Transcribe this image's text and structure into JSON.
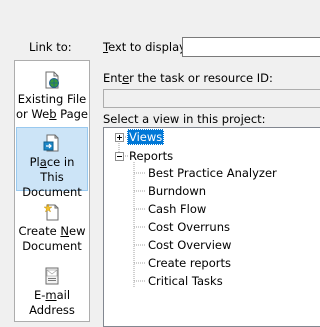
{
  "link_to": {
    "label": "Link to:",
    "items": [
      {
        "line1_pre": "",
        "line1_u": "",
        "line1_post": "Existing File",
        "line2_pre": "or We",
        "line2_u": "b",
        "line2_post": " Page",
        "icon": "globe-file-icon",
        "selected": false
      },
      {
        "line1_pre": "Pl",
        "line1_u": "a",
        "line1_post": "ce in This",
        "line2_pre": "Document",
        "line2_u": "",
        "line2_post": "",
        "icon": "document-arrow-icon",
        "selected": true
      },
      {
        "line1_pre": "Create ",
        "line1_u": "N",
        "line1_post": "ew",
        "line2_pre": "Document",
        "line2_u": "",
        "line2_post": "",
        "icon": "new-document-icon",
        "selected": false
      },
      {
        "line1_pre": "E-",
        "line1_u": "m",
        "line1_post": "ail",
        "line2_pre": "Address",
        "line2_u": "",
        "line2_post": "",
        "icon": "email-icon",
        "selected": false
      }
    ]
  },
  "text_to_display": {
    "label_u": "T",
    "label_rest": "ext to display:",
    "value": ""
  },
  "task_id": {
    "label_pre": "Ent",
    "label_u": "e",
    "label_post": "r the task or resource ID:",
    "value": ""
  },
  "views": {
    "label_pre": "Select a view in this pro",
    "label_u": "j",
    "label_post": "ect:",
    "root_views": "Views",
    "root_reports": "Reports",
    "reports": [
      "Best Practice Analyzer",
      "Burndown",
      "Cash Flow",
      "Cost Overruns",
      "Cost Overview",
      "Create reports",
      "Critical Tasks"
    ]
  },
  "colors": {
    "selection": "#0078d7",
    "sidebar_selected": "#cce4f7"
  }
}
